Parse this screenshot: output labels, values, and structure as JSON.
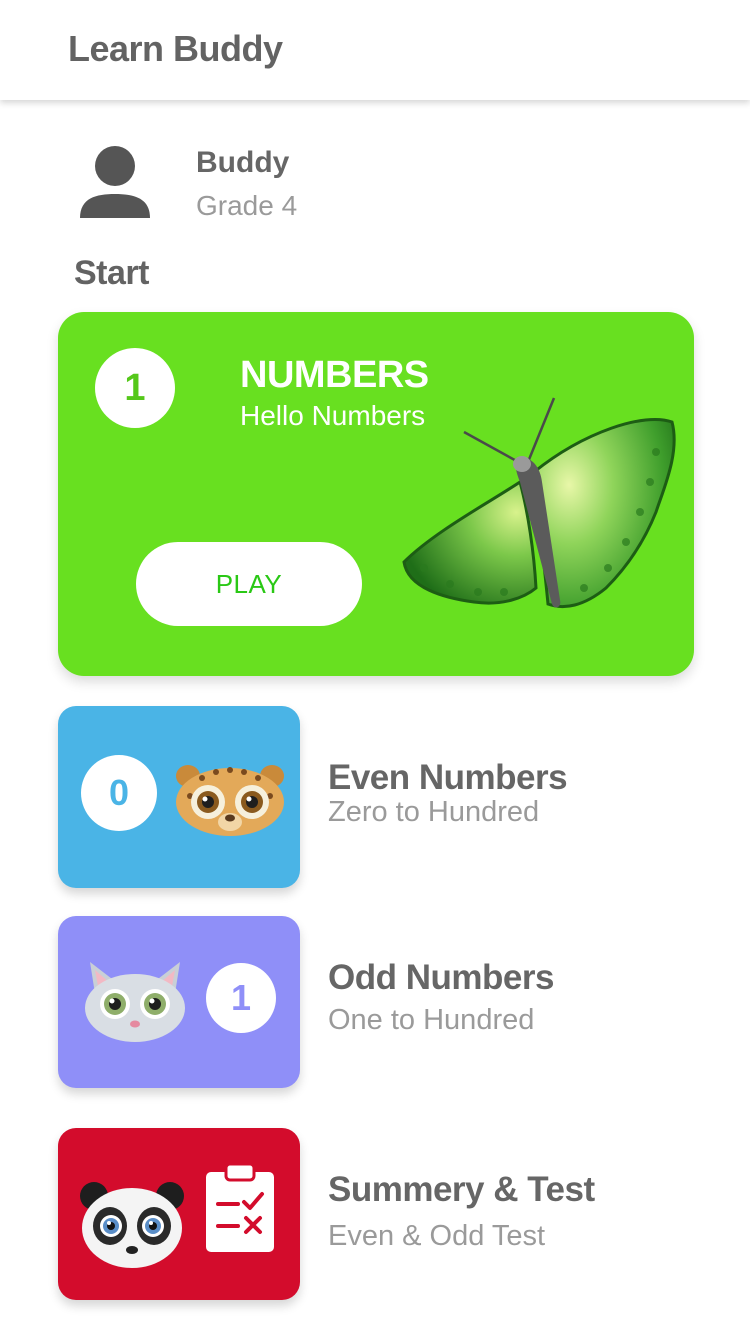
{
  "app": {
    "title": "Learn Buddy"
  },
  "profile": {
    "name": "Buddy",
    "grade": "Grade 4"
  },
  "section": {
    "title": "Start"
  },
  "featured": {
    "number": "1",
    "title": "NUMBERS",
    "subtitle": "Hello Numbers",
    "play_label": "PLAY",
    "image": "butterfly-illustration"
  },
  "lessons": [
    {
      "number": "0",
      "title": "Even Numbers",
      "subtitle": "Zero to Hundred",
      "tile_color": "#4ab4e6",
      "image": "leopard-face"
    },
    {
      "number": "1",
      "title": "Odd Numbers",
      "subtitle": "One to Hundred",
      "tile_color": "#8f8ff8",
      "image": "cat-face"
    },
    {
      "title": "Summery & Test",
      "subtitle": "Even & Odd Test",
      "tile_color": "#d30c2c",
      "image": "panda-face",
      "icon": "clipboard-check-icon"
    }
  ],
  "colors": {
    "featured_bg": "#68e020",
    "play_text": "#2ac815",
    "heading_text": "#636363",
    "secondary_text": "#9a9a9a"
  }
}
